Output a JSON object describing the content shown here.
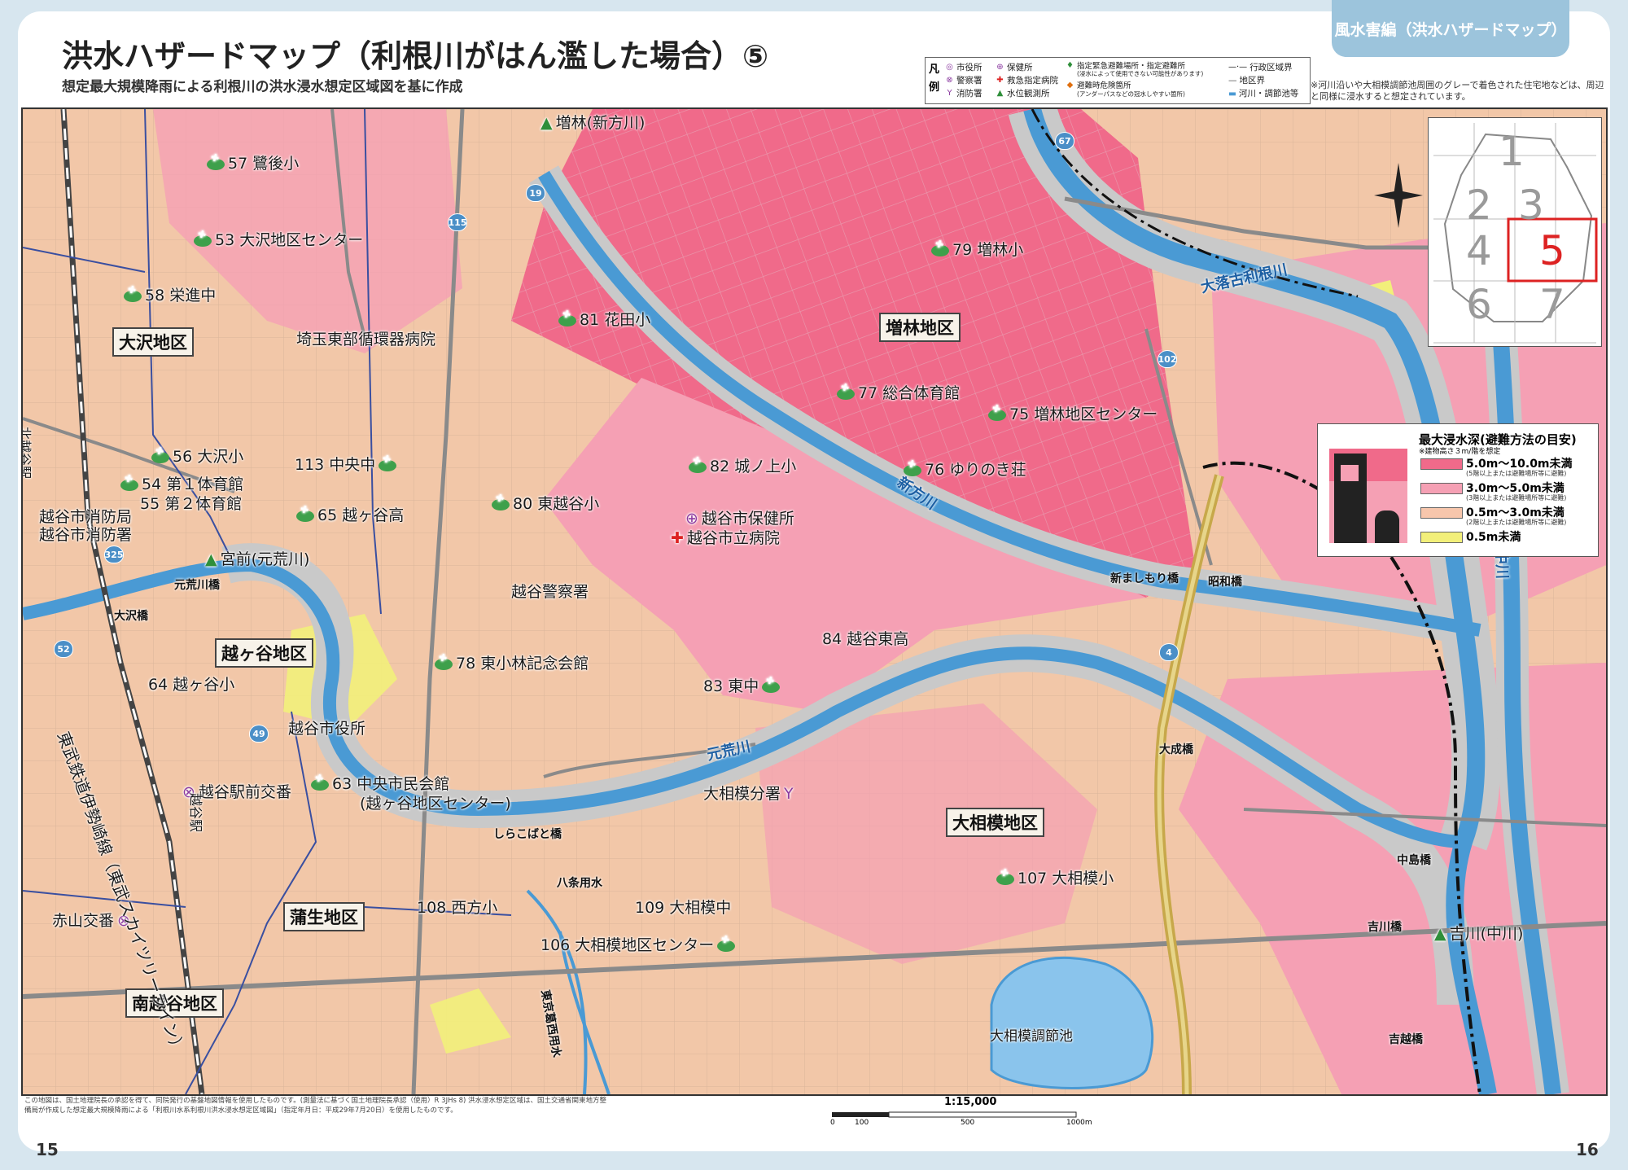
{
  "header": {
    "tab_label": "風水害編（洪水ハザードマップ）",
    "title": "洪水ハザードマップ（利根川がはん濫した場合）⑤",
    "subtitle": "想定最大規模降雨による利根川の洪水浸水想定区域図を基に作成"
  },
  "legend": {
    "heading": "凡例",
    "items": [
      {
        "sym": "◎",
        "label": "市役所",
        "color": "#8b3aa0"
      },
      {
        "sym": "⊗",
        "label": "警察署",
        "color": "#8b3aa0"
      },
      {
        "sym": "Y",
        "label": "消防署",
        "color": "#8b3aa0"
      },
      {
        "sym": "⊕",
        "label": "保健所",
        "color": "#8b3aa0"
      },
      {
        "sym": "✚",
        "label": "救急指定病院",
        "color": "#d22"
      },
      {
        "sym": "▲",
        "label": "水位観測所",
        "color": "#2f8f3a"
      },
      {
        "sym": "♦",
        "label": "指定緊急避難場所・指定避難所",
        "color": "#2f8f3a"
      },
      {
        "sym": "",
        "label": "(浸水によって使用できない可能性があります)",
        "color": "#333"
      },
      {
        "sym": "◆",
        "label": "避難時危険箇所",
        "color": "#e07010"
      },
      {
        "sym": "",
        "label": "(アンダーパスなどの冠水しやすい箇所)",
        "color": "#333"
      },
      {
        "sym": "—·—",
        "label": "行政区域界",
        "color": "#111"
      },
      {
        "sym": "—",
        "label": "地区界",
        "color": "#555"
      },
      {
        "sym": "▬",
        "label": "河川・調節池等",
        "color": "#4a9ad4"
      }
    ],
    "note": "※河川沿いや大相模調節池周囲のグレーで着色された住宅地などは、周辺と同様に浸水すると想定されています。"
  },
  "depth_legend": {
    "title": "最大浸水深(避難方法の目安)",
    "subtitle": "※建物高さ３m/階を想定",
    "rows": [
      {
        "label": "5.0m〜10.0m未満",
        "note": "(5階以上または避難場所等に避難)",
        "color": "#f06a8a"
      },
      {
        "label": "3.0m〜5.0m未満",
        "note": "(3階以上または避難場所等に避難)",
        "color": "#f5a0b4"
      },
      {
        "label": "0.5m〜3.0m未満",
        "note": "(2階以上または避難場所等に避難)",
        "color": "#f7c6ac"
      },
      {
        "label": "0.5m未満",
        "note": "",
        "color": "#f2ef7a"
      }
    ]
  },
  "index_map": {
    "cells": [
      "1",
      "2",
      "3",
      "4",
      "5",
      "6",
      "7"
    ],
    "current": "5"
  },
  "districts": [
    "大沢地区",
    "越ヶ谷地区",
    "増林地区",
    "大相模地区",
    "蒲生地区",
    "南越谷地区"
  ],
  "shelters": [
    "57 鷺後小",
    "53 大沢地区センター",
    "58 栄進中",
    "81 花田小",
    "79 増林小",
    "77 総合体育館",
    "75 増林地区センター",
    "76 ゆりのき荘",
    "82 城ノ上小",
    "56 大沢小",
    "54 第１体育館",
    "55 第２体育館",
    "113 中央中",
    "65 越ヶ谷高",
    "80 東越谷小",
    "78 東小林記念会館",
    "84 越谷東高",
    "83 東中",
    "64 越ヶ谷小",
    "63 中央市民会館",
    "(越ヶ谷地区センター)",
    "107 大相模小",
    "108 西方小",
    "109 大相模中",
    "106 大相模地区センター"
  ],
  "facilities": [
    "埼玉東部循環器病院",
    "越谷市消防局",
    "越谷市消防署",
    "越谷市保健所",
    "越谷市立病院",
    "越谷警察署",
    "越谷市役所",
    "越谷駅前交番",
    "大相模分署",
    "赤山交番"
  ],
  "gauges": [
    "増林(新方川)",
    "宮前(元荒川)",
    "吉川(中川)"
  ],
  "rivers": [
    "大落古利根川",
    "新方川",
    "元荒川",
    "中川",
    "八条用水",
    "東京葛西用水",
    "葛西用水"
  ],
  "rail": [
    "東武鉄道伊勢崎線（東武スカイツリーライン）",
    "北越谷駅",
    "越谷駅"
  ],
  "bridges": [
    "元荒川橋",
    "大沢橋",
    "新ましもり橋",
    "昭和橋",
    "大成橋",
    "しらこばと橋",
    "中島橋",
    "吉川橋",
    "吉越橋"
  ],
  "water_body": "大相模調節池",
  "routes": [
    "115",
    "19",
    "67",
    "102",
    "325",
    "52",
    "49",
    "4"
  ],
  "scale": {
    "ratio": "1:15,000",
    "ticks": [
      "0",
      "100",
      "500",
      "1000m"
    ]
  },
  "footer_note": "この地図は、国土地理院長の承認を得て、同院発行の基盤地図情報を使用したものです。(測量法に基づく国土地理院長承認（使用）R 3JHs 8) 洪水浸水想定区域は、国土交通省関東地方整備局が作成した想定最大規模降雨による「利根川水系利根川洪水浸水想定区域図」（指定年月日：平成29年7月20日）を使用したものです。",
  "page_numbers": {
    "left": "15",
    "right": "16"
  },
  "colors": {
    "depth_5_10": "#f06a8a",
    "depth_3_5": "#f5a0b4",
    "depth_05_3": "#f2c7a8",
    "depth_lt05": "#f2ef7a",
    "river": "#4a9ad4",
    "shelter": "#3ea04b"
  }
}
